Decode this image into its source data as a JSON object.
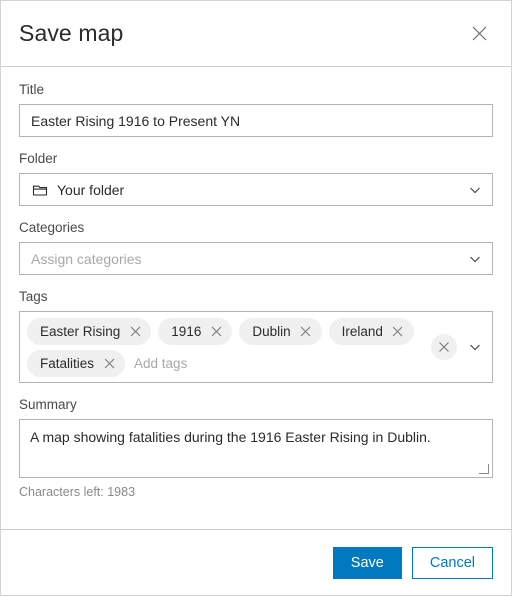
{
  "dialog": {
    "title": "Save map",
    "close_icon": "close-icon"
  },
  "accent_color": "#0079c1",
  "fields": {
    "title": {
      "label": "Title",
      "value": "Easter Rising 1916 to Present YN",
      "placeholder": "Title"
    },
    "folder": {
      "label": "Folder",
      "value": "Your folder",
      "icon": "folder-icon",
      "chevron": "chevron-down-icon"
    },
    "categories": {
      "label": "Categories",
      "value": "",
      "placeholder": "Assign categories",
      "chevron": "chevron-down-icon"
    },
    "tags": {
      "label": "Tags",
      "items": [
        {
          "label": "Easter Rising",
          "remove_icon": "close-icon"
        },
        {
          "label": "1916",
          "remove_icon": "close-icon"
        },
        {
          "label": "Dublin",
          "remove_icon": "close-icon"
        },
        {
          "label": "Ireland",
          "remove_icon": "close-icon"
        },
        {
          "label": "Fatalities",
          "remove_icon": "close-icon"
        }
      ],
      "input_placeholder": "Add tags",
      "input_value": "",
      "clear_icon": "close-icon",
      "chevron": "chevron-down-icon"
    },
    "summary": {
      "label": "Summary",
      "value": "A map showing fatalities during the 1916 Easter Rising in Dublin.",
      "placeholder": "Summary",
      "characters_left": "Characters left: 1983"
    }
  },
  "footer": {
    "save_label": "Save",
    "cancel_label": "Cancel"
  }
}
